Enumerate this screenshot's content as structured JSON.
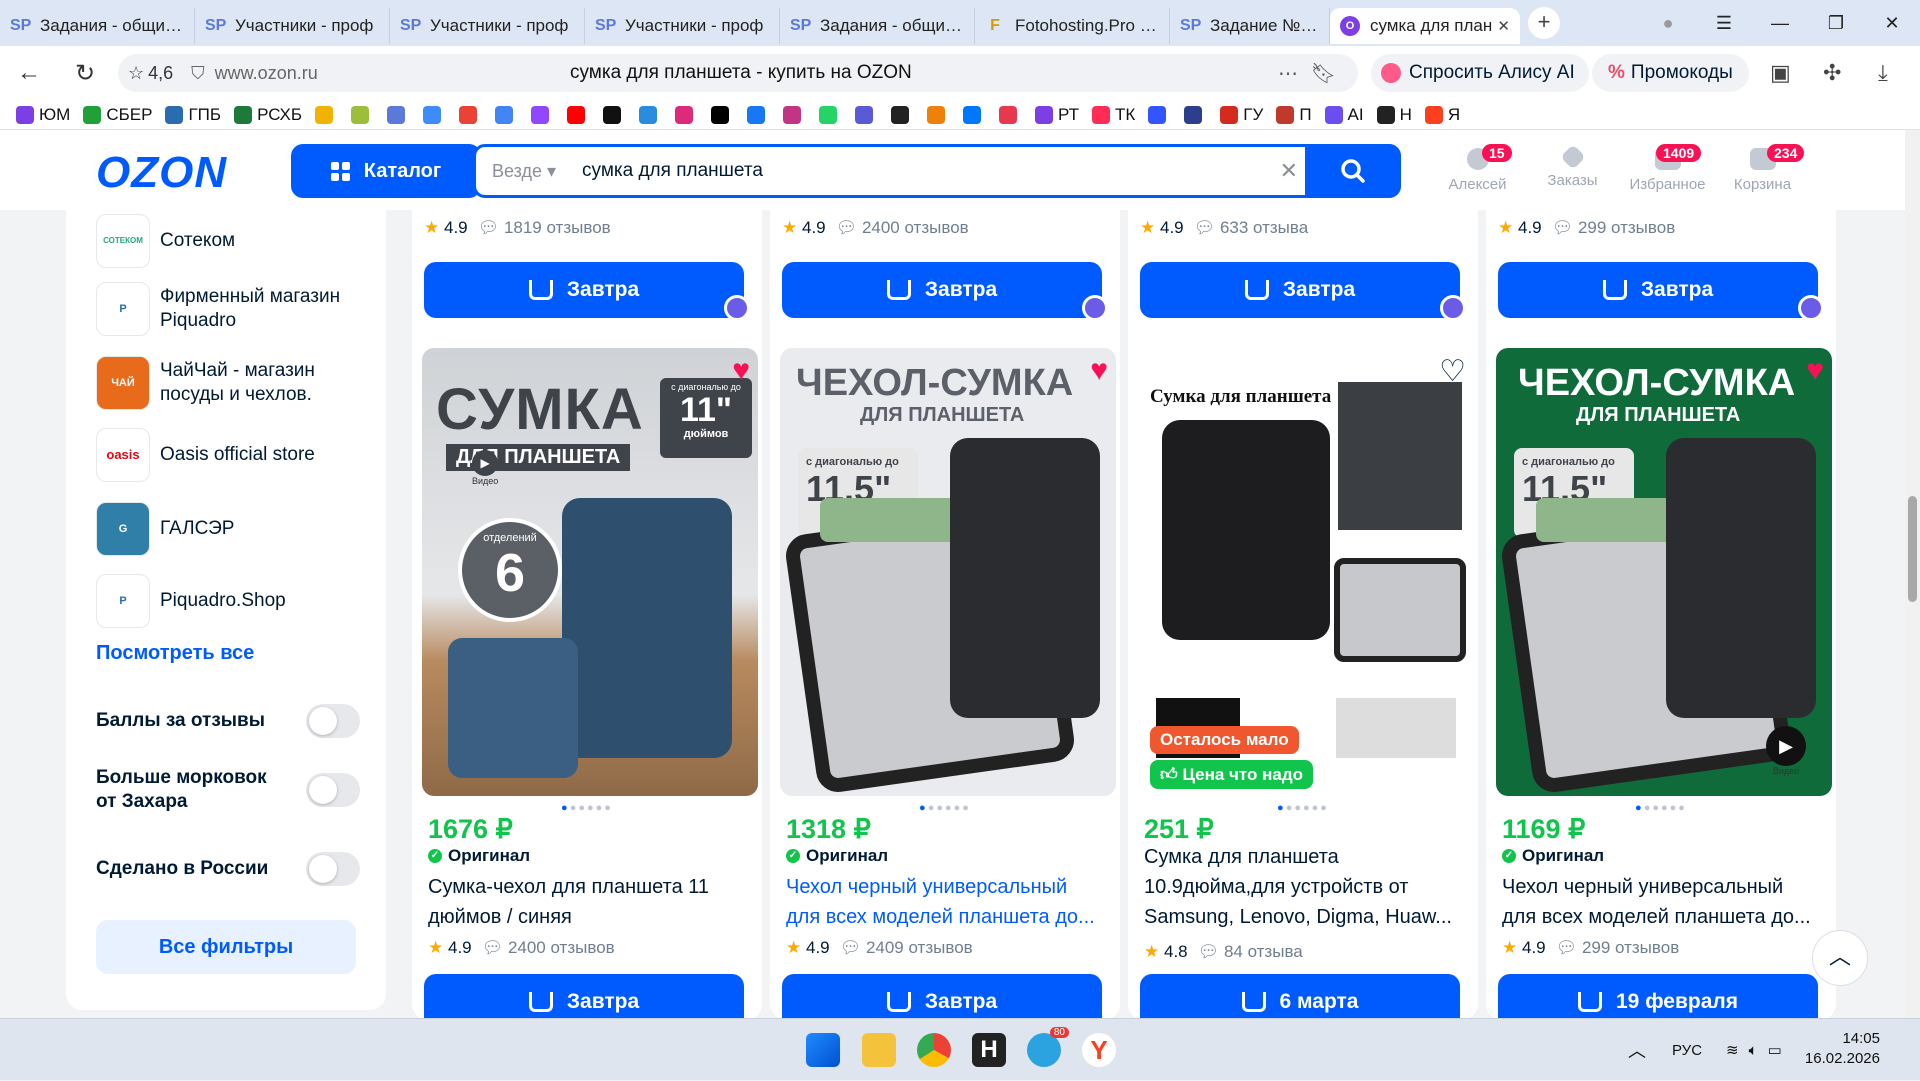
{
  "browser": {
    "tabs": [
      {
        "label": "Задания - общий с",
        "icon": "SP"
      },
      {
        "label": "Участники - проф",
        "icon": "SP"
      },
      {
        "label": "Участники - проф",
        "icon": "SP"
      },
      {
        "label": "Участники - проф",
        "icon": "SP"
      },
      {
        "label": "Задания - общий с",
        "icon": "SP"
      },
      {
        "label": "Fotohosting.Pro - С",
        "icon": "F"
      },
      {
        "label": "Задание №28961",
        "icon": "SP"
      }
    ],
    "active_tab": {
      "label": "сумка для план",
      "icon": "O"
    },
    "rating": "4,6",
    "domain": "www.ozon.ru",
    "page_title": "сумка для планшета - купить на OZON",
    "alice_label": "Спросить Алису AI",
    "promo_label": "Промокоды",
    "bookmarks": [
      {
        "label": "ЮМ",
        "color": "#7b3fe4"
      },
      {
        "label": "СБЕР",
        "color": "#21a038"
      },
      {
        "label": "ГПБ",
        "color": "#2b6cb0"
      },
      {
        "label": "РСХБ",
        "color": "#1e7a3a"
      },
      {
        "label": "",
        "color": "#f0b400"
      },
      {
        "label": "",
        "color": "#9bbf3a"
      },
      {
        "label": "",
        "color": "#5b7ad8"
      },
      {
        "label": "",
        "color": "#3d8bfd"
      },
      {
        "label": "",
        "color": "#ea4335"
      },
      {
        "label": "",
        "color": "#4285f4"
      },
      {
        "label": "",
        "color": "#9146ff"
      },
      {
        "label": "",
        "color": "#ff0000"
      },
      {
        "label": "",
        "color": "#111111"
      },
      {
        "label": "",
        "color": "#2a8cde"
      },
      {
        "label": "",
        "color": "#dd2a7b"
      },
      {
        "label": "",
        "color": "#000000"
      },
      {
        "label": "",
        "color": "#1877f2"
      },
      {
        "label": "",
        "color": "#c13584"
      },
      {
        "label": "",
        "color": "#25d366"
      },
      {
        "label": "",
        "color": "#5a5ad6"
      },
      {
        "label": "",
        "color": "#222222"
      },
      {
        "label": "",
        "color": "#ee8208"
      },
      {
        "label": "",
        "color": "#0077ff"
      },
      {
        "label": "",
        "color": "#e8384f"
      },
      {
        "label": "РТ",
        "color": "#7b3fe4"
      },
      {
        "label": "ТК",
        "color": "#ff2d55"
      },
      {
        "label": "",
        "color": "#3355ff"
      },
      {
        "label": "",
        "color": "#2c3e8c"
      },
      {
        "label": "ГУ",
        "color": "#d52b1e"
      },
      {
        "label": "П",
        "color": "#c0392b"
      },
      {
        "label": "AI",
        "color": "#6b4df0"
      },
      {
        "label": "Н",
        "color": "#222222"
      },
      {
        "label": "Я",
        "color": "#fc3f1d"
      }
    ]
  },
  "header": {
    "logo": "OZON",
    "catalog_label": "Каталог",
    "search_scope": "Везде",
    "search_query": "сумка для планшета",
    "icons": [
      {
        "label": "Алексей",
        "badge": "15"
      },
      {
        "label": "Заказы",
        "badge": ""
      },
      {
        "label": "Избранное",
        "badge": "1409"
      },
      {
        "label": "Корзина",
        "badge": "234"
      }
    ]
  },
  "sidebar": {
    "brands": [
      {
        "name": "Сотеком",
        "logo_text": "СОТЕКОМ"
      },
      {
        "name": "Фирменный магазин Piquadro",
        "logo_text": "P"
      },
      {
        "name": "ЧайЧай - магазин посуды и чехлов.",
        "logo_text": "ЧАЙ"
      },
      {
        "name": "Oasis official store",
        "logo_text": "oasis"
      },
      {
        "name": "ГАЛСЭР",
        "logo_text": "G"
      },
      {
        "name": "Piquadro.Shop",
        "logo_text": "P"
      }
    ],
    "see_all": "Посмотреть все",
    "toggles": [
      {
        "label": "Баллы за отзывы"
      },
      {
        "label": "Больше морковок от Захара"
      },
      {
        "label": "Сделано в России"
      }
    ],
    "all_filters": "Все фильтры"
  },
  "top_row": [
    {
      "rating": "4.9",
      "reviews": "1819 отзывов",
      "button": "Завтра"
    },
    {
      "rating": "4.9",
      "reviews": "2400 отзывов",
      "button": "Завтра"
    },
    {
      "rating": "4.9",
      "reviews": "633 отзыва",
      "button": "Завтра"
    },
    {
      "rating": "4.9",
      "reviews": "299 отзывов",
      "button": "Завтра"
    }
  ],
  "products": [
    {
      "price": "1676 ₽",
      "original": "Оригинал",
      "title": "Сумка-чехол для планшета 11 дюймов / синяя",
      "rating": "4.9",
      "reviews": "2400 отзывов",
      "button": "Завтра",
      "favorite": true,
      "img_headline": "СУМКА",
      "img_sub": "ДЛЯ ПЛАНШЕТА",
      "img_badge_small": "с диагональю до",
      "img_badge_big": "11\"",
      "img_badge_unit": "дюймов",
      "img_circle_top": "отделений",
      "img_circle_num": "6",
      "img_video": "Видео"
    },
    {
      "price": "1318 ₽",
      "original": "Оригинал",
      "title": "Чехол черный универсальный для всех моделей планшета до...",
      "rating": "4.9",
      "reviews": "2409 отзывов",
      "button": "Завтра",
      "favorite": true,
      "img_headline": "ЧЕХОЛ-СУМКА",
      "img_sub": "ДЛЯ ПЛАНШЕТА",
      "img_badge_small": "с диагональю до",
      "img_badge_big": "11,5\""
    },
    {
      "price": "251 ₽",
      "original": "",
      "title": "Сумка для планшета 10.9дюйма,для устройств от Samsung, Lenovo, Digma, Huaw...",
      "rating": "4.8",
      "reviews": "84 отзыва",
      "button": "6 марта",
      "favorite": false,
      "img_headline": "Сумка для планшета",
      "tag_low": "Осталось мало",
      "tag_price": "Цена что надо"
    },
    {
      "price": "1169 ₽",
      "original": "Оригинал",
      "title": "Чехол черный универсальный для всех моделей планшета до...",
      "rating": "4.9",
      "reviews": "299 отзывов",
      "button": "19 февраля",
      "favorite": true,
      "img_headline": "ЧЕХОЛ-СУМКА",
      "img_sub": "ДЛЯ ПЛАНШЕТА",
      "img_badge_small": "с диагональю до",
      "img_badge_big": "11,5\"",
      "img_video": "Видео"
    }
  ],
  "taskbar": {
    "lang": "РУС",
    "time": "14:05",
    "date": "16.02.2026",
    "telegram_badge": "80"
  },
  "colors": {
    "ozon_blue": "#005bff",
    "price_green": "#10c44c",
    "favorite_red": "#f91155"
  }
}
